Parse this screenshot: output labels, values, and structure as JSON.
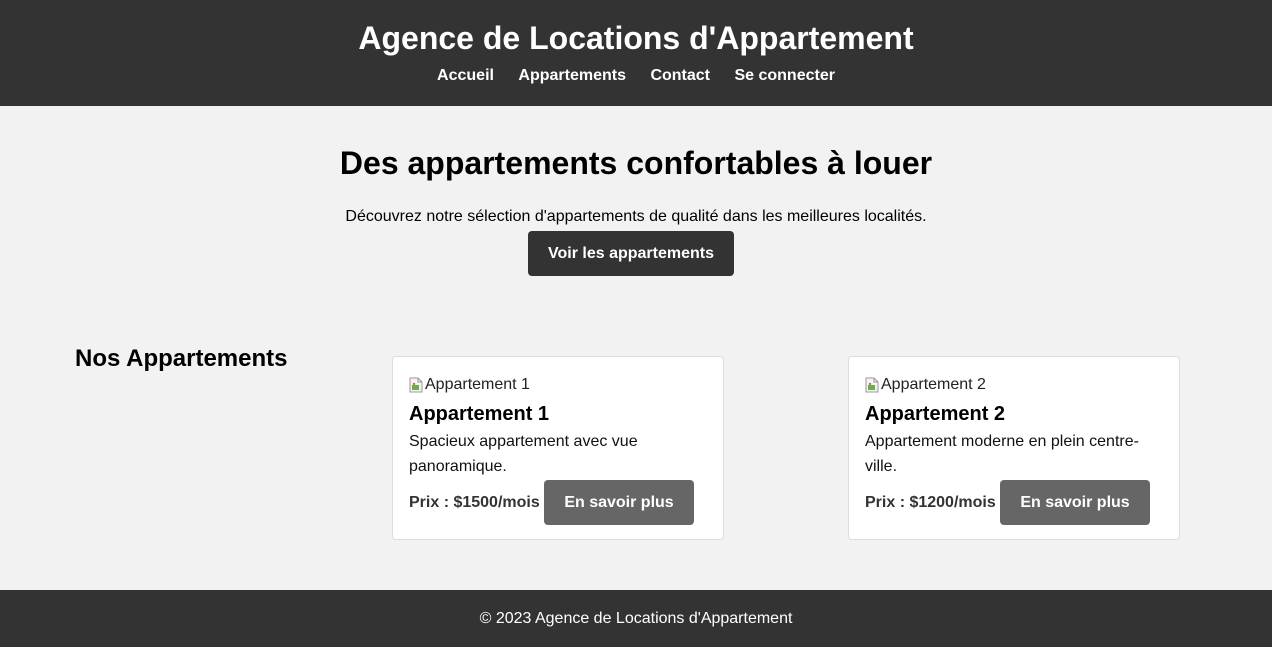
{
  "header": {
    "title": "Agence de Locations d'Appartement",
    "nav": [
      {
        "label": "Accueil"
      },
      {
        "label": "Appartements"
      },
      {
        "label": "Contact"
      },
      {
        "label": "Se connecter"
      }
    ]
  },
  "hero": {
    "title": "Des appartements confortables à louer",
    "text": "Découvrez notre sélection d'appartements de qualité dans les meilleures localités.",
    "button_label": "Voir les appartements"
  },
  "listings": {
    "section_title": "Nos Appartements",
    "cards": [
      {
        "image_alt": "Appartement 1",
        "title": "Appartement 1",
        "description": "Spacieux appartement avec vue panoramique.",
        "price": "Prix : $1500/mois",
        "button_label": "En savoir plus"
      },
      {
        "image_alt": "Appartement 2",
        "title": "Appartement 2",
        "description": "Appartement moderne en plein centre-ville.",
        "price": "Prix : $1200/mois",
        "button_label": "En savoir plus"
      }
    ]
  },
  "footer": {
    "text": "© 2023 Agence de Locations d'Appartement"
  },
  "colors": {
    "header_bg": "#333333",
    "page_bg": "#f2f2f2",
    "card_button_bg": "#666666"
  },
  "icons": {
    "broken_image": "broken-image-icon"
  }
}
